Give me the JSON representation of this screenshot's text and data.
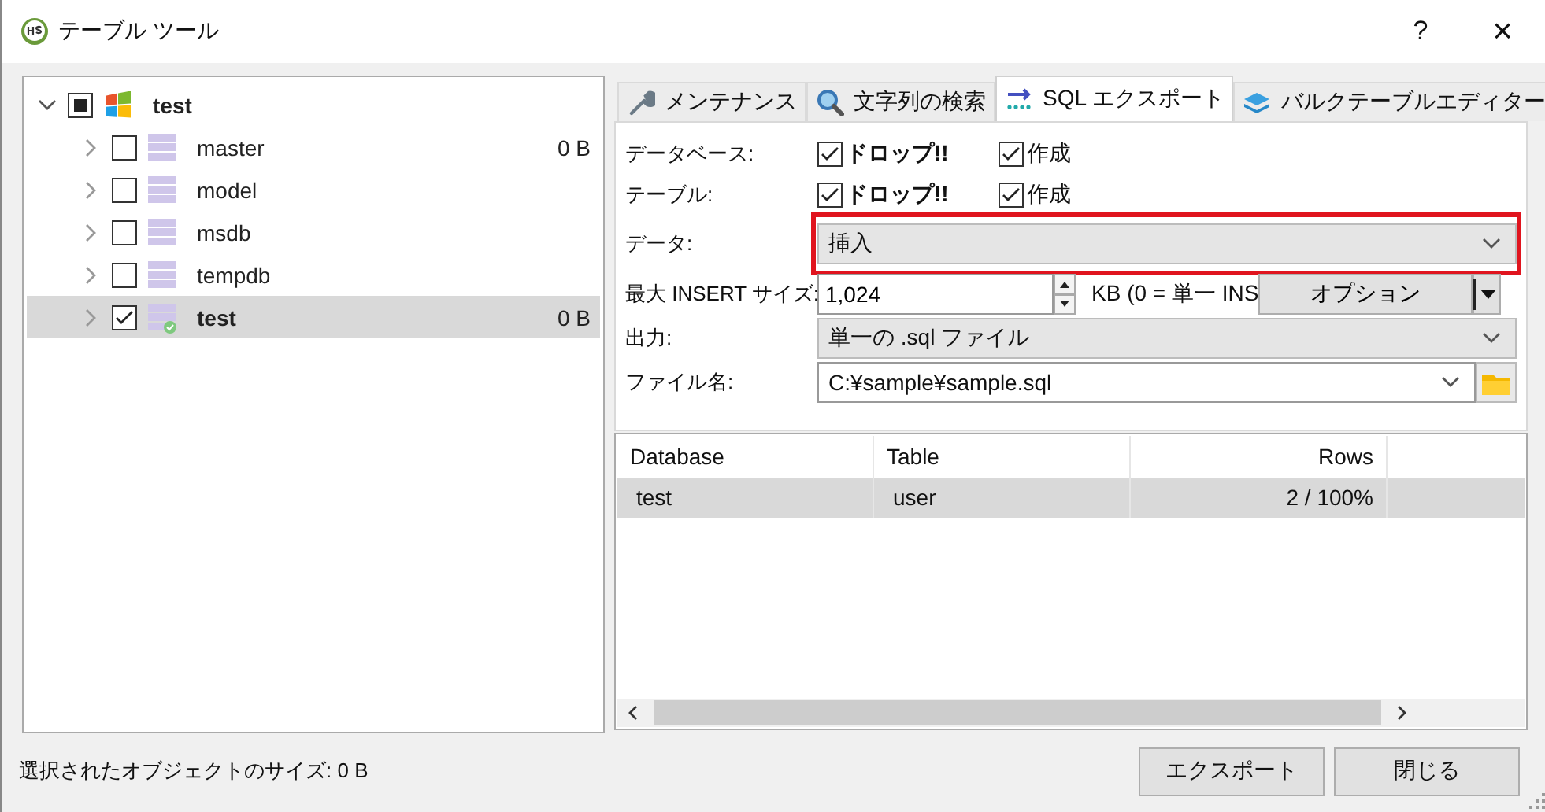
{
  "window": {
    "title": "テーブル ツール",
    "help": "?",
    "close": "×"
  },
  "tree": {
    "label": "test",
    "indeterminate": true,
    "expanded": true,
    "active": true,
    "children": [
      {
        "label": "master",
        "checked": false,
        "expanded": false,
        "size": "0 B",
        "selected": false,
        "active": false,
        "connected": false
      },
      {
        "label": "model",
        "checked": false,
        "expanded": false,
        "selected": false,
        "active": false,
        "connected": false
      },
      {
        "label": "msdb",
        "checked": false,
        "expanded": false,
        "selected": false,
        "active": false,
        "connected": false
      },
      {
        "label": "tempdb",
        "checked": false,
        "expanded": false,
        "selected": false,
        "active": false,
        "connected": false
      },
      {
        "label": "test",
        "checked": true,
        "expanded": false,
        "size": "0 B",
        "selected": true,
        "active": true,
        "connected": true
      }
    ]
  },
  "tabs": [
    {
      "label": "メンテナンス",
      "kind": "wrench",
      "selected": false
    },
    {
      "label": "文字列の検索",
      "kind": "search",
      "selected": false
    },
    {
      "label": "SQL エクスポート",
      "kind": "arrows",
      "selected": true
    },
    {
      "label": "バルクテーブルエディター",
      "kind": "layers",
      "selected": false
    }
  ],
  "options": [
    {
      "label": "データベース:",
      "checks": [
        {
          "label": "ドロップ!!",
          "checked": true,
          "bold": true
        },
        {
          "label": "作成",
          "checked": true,
          "bold": false
        }
      ]
    },
    {
      "label": "テーブル:",
      "checks": [
        {
          "label": "ドロップ!!",
          "checked": true,
          "bold": true
        },
        {
          "label": "作成",
          "checked": true,
          "bold": false
        }
      ]
    }
  ],
  "data": {
    "label": "データ:",
    "value": "挿入",
    "highlighted": true
  },
  "max_insert": {
    "label": "最大 INSERT サイズ:",
    "value": "1,024",
    "suffix": "KB (0 = 単一 INS",
    "button": "オプション"
  },
  "output": {
    "label": "出力:",
    "value": "単一の .sql ファイル"
  },
  "file": {
    "label": "ファイル名:",
    "value": "C:¥sample¥sample.sql"
  },
  "table": {
    "columns": [
      {
        "label": "Database",
        "align_right": false
      },
      {
        "label": "Table",
        "align_right": false
      },
      {
        "label": "Rows",
        "align_right": true
      }
    ],
    "rows": [
      {
        "cells": [
          "test",
          "user",
          "2 / 100%"
        ],
        "selected": true
      }
    ]
  },
  "status": "選択されたオブジェクトのサイズ: 0 B",
  "buttons": [
    "エクスポート",
    "閉じる"
  ]
}
